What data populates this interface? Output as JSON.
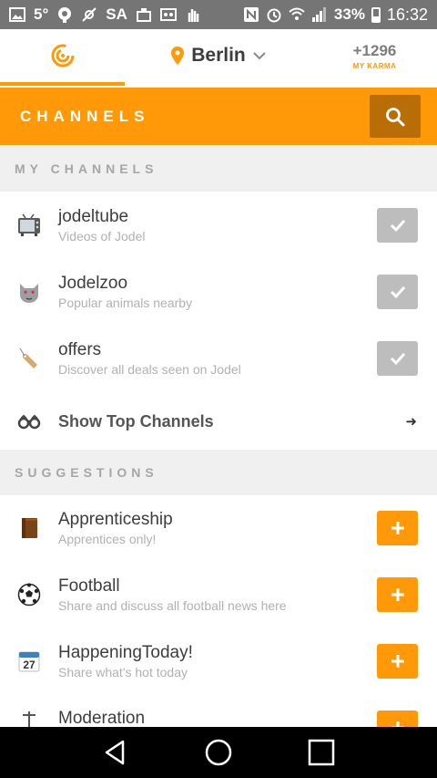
{
  "status_bar": {
    "temperature": "5°",
    "carrier": "SA",
    "battery": "33%",
    "time": "16:32"
  },
  "nav": {
    "city": "Berlin",
    "karma_value": "+1296",
    "karma_label": "MY KARMA"
  },
  "header": {
    "title": "CHANNELS"
  },
  "sections": {
    "my_channels": "MY CHANNELS",
    "suggestions": "SUGGESTIONS"
  },
  "my_channels": [
    {
      "title": "jodeltube",
      "subtitle": "Videos of Jodel",
      "icon": "tv-icon"
    },
    {
      "title": "Jodelzoo",
      "subtitle": "Popular animals nearby",
      "icon": "cat-face-icon"
    },
    {
      "title": "offers",
      "subtitle": "Discover all deals seen on Jodel",
      "icon": "price-tag-icon"
    }
  ],
  "show_top": "Show Top Channels",
  "suggestions": [
    {
      "title": "Apprenticeship",
      "subtitle": "Apprentices only!",
      "icon": "book-icon"
    },
    {
      "title": "Football",
      "subtitle": "Share and discuss all football news here",
      "icon": "soccer-ball-icon"
    },
    {
      "title": "HappeningToday!",
      "subtitle": "Share what's hot today",
      "icon": "calendar-icon",
      "calendar_day": "27"
    },
    {
      "title": "Moderation",
      "subtitle": "",
      "icon": "moderation-icon"
    }
  ],
  "colors": {
    "accent": "#ff9908",
    "accent_dark": "#b86e04",
    "checked": "#bdbdbd"
  }
}
